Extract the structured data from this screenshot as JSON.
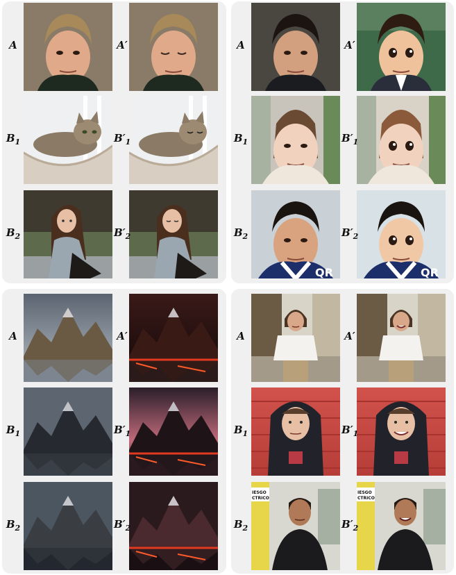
{
  "panels": [
    {
      "id": "face-edit",
      "rows": [
        {
          "left": {
            "letter": "A",
            "sub": "",
            "prime": false
          },
          "right": {
            "letter": "A",
            "sub": "",
            "prime": true
          },
          "img_left": "portrait-man-eyes-open",
          "img_right": "portrait-man-eyes-closed"
        },
        {
          "left": {
            "letter": "B",
            "sub": "1",
            "prime": false
          },
          "right": {
            "letter": "B",
            "sub": "1",
            "prime": true
          },
          "img_left": "cat-in-basket-eyes-open",
          "img_right": "cat-in-basket-eyes-closed"
        },
        {
          "left": {
            "letter": "B",
            "sub": "2",
            "prime": false
          },
          "right": {
            "letter": "B",
            "sub": "2",
            "prime": true
          },
          "img_left": "woman-sitting-photo",
          "img_right": "woman-sitting-eyes-closed"
        }
      ]
    },
    {
      "id": "anime-style",
      "rows": [
        {
          "left": {
            "letter": "A",
            "sub": "",
            "prime": false
          },
          "right": {
            "letter": "A",
            "sub": "",
            "prime": true
          },
          "img_left": "man-photo",
          "img_right": "man-anime"
        },
        {
          "left": {
            "letter": "B",
            "sub": "1",
            "prime": false
          },
          "right": {
            "letter": "B",
            "sub": "1",
            "prime": true
          },
          "img_left": "woman-street-photo",
          "img_right": "woman-street-anime"
        },
        {
          "left": {
            "letter": "B",
            "sub": "2",
            "prime": false
          },
          "right": {
            "letter": "B",
            "sub": "2",
            "prime": true
          },
          "img_left": "man-jacket-photo",
          "img_right": "man-jacket-anime"
        }
      ]
    },
    {
      "id": "lava-style",
      "rows": [
        {
          "left": {
            "letter": "A",
            "sub": "",
            "prime": false
          },
          "right": {
            "letter": "A",
            "sub": "",
            "prime": true
          },
          "img_left": "mountain-lake",
          "img_right": "mountain-lake-lava"
        },
        {
          "left": {
            "letter": "B",
            "sub": "1",
            "prime": false
          },
          "right": {
            "letter": "B",
            "sub": "1",
            "prime": true
          },
          "img_left": "mountain-reflection",
          "img_right": "mountain-reflection-red"
        },
        {
          "left": {
            "letter": "B",
            "sub": "2",
            "prime": false
          },
          "right": {
            "letter": "B",
            "sub": "2",
            "prime": true
          },
          "img_left": "snowy-peaks-lake",
          "img_right": "snowy-peaks-lake-red"
        }
      ]
    },
    {
      "id": "smile-edit",
      "rows": [
        {
          "left": {
            "letter": "A",
            "sub": "",
            "prime": false
          },
          "right": {
            "letter": "A",
            "sub": "",
            "prime": true
          },
          "img_left": "woman-street-neutral",
          "img_right": "woman-street-smile"
        },
        {
          "left": {
            "letter": "B",
            "sub": "1",
            "prime": false
          },
          "right": {
            "letter": "B",
            "sub": "1",
            "prime": true
          },
          "img_left": "man-hoodie-neutral",
          "img_right": "man-hoodie-smile"
        },
        {
          "left": {
            "letter": "B",
            "sub": "2",
            "prime": false
          },
          "right": {
            "letter": "B",
            "sub": "2",
            "prime": true
          },
          "img_left": "man-street-neutral",
          "img_right": "man-street-smile"
        }
      ]
    }
  ],
  "sign_text_1": "IESGO",
  "sign_text_2": "CTRICO",
  "jacket_text": "QR"
}
